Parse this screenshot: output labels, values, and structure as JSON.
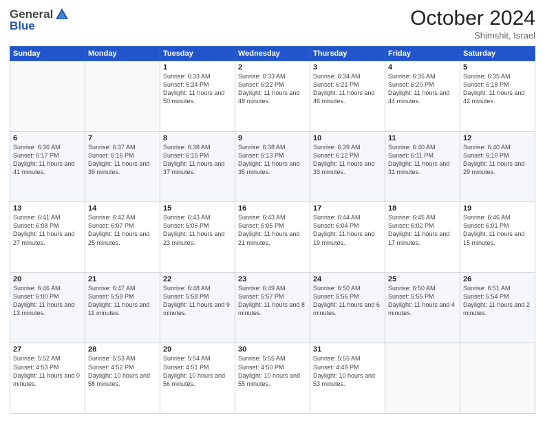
{
  "logo": {
    "general": "General",
    "blue": "Blue"
  },
  "title": "October 2024",
  "subtitle": "Shimshit, Israel",
  "weekdays": [
    "Sunday",
    "Monday",
    "Tuesday",
    "Wednesday",
    "Thursday",
    "Friday",
    "Saturday"
  ],
  "weeks": [
    [
      {
        "day": "",
        "sunrise": "",
        "sunset": "",
        "daylight": ""
      },
      {
        "day": "",
        "sunrise": "",
        "sunset": "",
        "daylight": ""
      },
      {
        "day": "1",
        "sunrise": "Sunrise: 6:33 AM",
        "sunset": "Sunset: 6:24 PM",
        "daylight": "Daylight: 11 hours and 50 minutes."
      },
      {
        "day": "2",
        "sunrise": "Sunrise: 6:33 AM",
        "sunset": "Sunset: 6:22 PM",
        "daylight": "Daylight: 11 hours and 48 minutes."
      },
      {
        "day": "3",
        "sunrise": "Sunrise: 6:34 AM",
        "sunset": "Sunset: 6:21 PM",
        "daylight": "Daylight: 11 hours and 46 minutes."
      },
      {
        "day": "4",
        "sunrise": "Sunrise: 6:35 AM",
        "sunset": "Sunset: 6:20 PM",
        "daylight": "Daylight: 11 hours and 44 minutes."
      },
      {
        "day": "5",
        "sunrise": "Sunrise: 6:35 AM",
        "sunset": "Sunset: 6:18 PM",
        "daylight": "Daylight: 11 hours and 42 minutes."
      }
    ],
    [
      {
        "day": "6",
        "sunrise": "Sunrise: 6:36 AM",
        "sunset": "Sunset: 6:17 PM",
        "daylight": "Daylight: 11 hours and 41 minutes."
      },
      {
        "day": "7",
        "sunrise": "Sunrise: 6:37 AM",
        "sunset": "Sunset: 6:16 PM",
        "daylight": "Daylight: 11 hours and 39 minutes."
      },
      {
        "day": "8",
        "sunrise": "Sunrise: 6:38 AM",
        "sunset": "Sunset: 6:15 PM",
        "daylight": "Daylight: 11 hours and 37 minutes."
      },
      {
        "day": "9",
        "sunrise": "Sunrise: 6:38 AM",
        "sunset": "Sunset: 6:13 PM",
        "daylight": "Daylight: 11 hours and 35 minutes."
      },
      {
        "day": "10",
        "sunrise": "Sunrise: 6:39 AM",
        "sunset": "Sunset: 6:12 PM",
        "daylight": "Daylight: 11 hours and 33 minutes."
      },
      {
        "day": "11",
        "sunrise": "Sunrise: 6:40 AM",
        "sunset": "Sunset: 6:11 PM",
        "daylight": "Daylight: 11 hours and 31 minutes."
      },
      {
        "day": "12",
        "sunrise": "Sunrise: 6:40 AM",
        "sunset": "Sunset: 6:10 PM",
        "daylight": "Daylight: 11 hours and 29 minutes."
      }
    ],
    [
      {
        "day": "13",
        "sunrise": "Sunrise: 6:41 AM",
        "sunset": "Sunset: 6:08 PM",
        "daylight": "Daylight: 11 hours and 27 minutes."
      },
      {
        "day": "14",
        "sunrise": "Sunrise: 6:42 AM",
        "sunset": "Sunset: 6:07 PM",
        "daylight": "Daylight: 11 hours and 25 minutes."
      },
      {
        "day": "15",
        "sunrise": "Sunrise: 6:43 AM",
        "sunset": "Sunset: 6:06 PM",
        "daylight": "Daylight: 11 hours and 23 minutes."
      },
      {
        "day": "16",
        "sunrise": "Sunrise: 6:43 AM",
        "sunset": "Sunset: 6:05 PM",
        "daylight": "Daylight: 11 hours and 21 minutes."
      },
      {
        "day": "17",
        "sunrise": "Sunrise: 6:44 AM",
        "sunset": "Sunset: 6:04 PM",
        "daylight": "Daylight: 11 hours and 19 minutes."
      },
      {
        "day": "18",
        "sunrise": "Sunrise: 6:45 AM",
        "sunset": "Sunset: 6:02 PM",
        "daylight": "Daylight: 11 hours and 17 minutes."
      },
      {
        "day": "19",
        "sunrise": "Sunrise: 6:46 AM",
        "sunset": "Sunset: 6:01 PM",
        "daylight": "Daylight: 11 hours and 15 minutes."
      }
    ],
    [
      {
        "day": "20",
        "sunrise": "Sunrise: 6:46 AM",
        "sunset": "Sunset: 6:00 PM",
        "daylight": "Daylight: 11 hours and 13 minutes."
      },
      {
        "day": "21",
        "sunrise": "Sunrise: 6:47 AM",
        "sunset": "Sunset: 5:59 PM",
        "daylight": "Daylight: 11 hours and 11 minutes."
      },
      {
        "day": "22",
        "sunrise": "Sunrise: 6:48 AM",
        "sunset": "Sunset: 5:58 PM",
        "daylight": "Daylight: 11 hours and 9 minutes."
      },
      {
        "day": "23",
        "sunrise": "Sunrise: 6:49 AM",
        "sunset": "Sunset: 5:57 PM",
        "daylight": "Daylight: 11 hours and 8 minutes."
      },
      {
        "day": "24",
        "sunrise": "Sunrise: 6:50 AM",
        "sunset": "Sunset: 5:56 PM",
        "daylight": "Daylight: 11 hours and 6 minutes."
      },
      {
        "day": "25",
        "sunrise": "Sunrise: 6:50 AM",
        "sunset": "Sunset: 5:55 PM",
        "daylight": "Daylight: 11 hours and 4 minutes."
      },
      {
        "day": "26",
        "sunrise": "Sunrise: 6:51 AM",
        "sunset": "Sunset: 5:54 PM",
        "daylight": "Daylight: 11 hours and 2 minutes."
      }
    ],
    [
      {
        "day": "27",
        "sunrise": "Sunrise: 5:52 AM",
        "sunset": "Sunset: 4:53 PM",
        "daylight": "Daylight: 11 hours and 0 minutes."
      },
      {
        "day": "28",
        "sunrise": "Sunrise: 5:53 AM",
        "sunset": "Sunset: 4:52 PM",
        "daylight": "Daylight: 10 hours and 58 minutes."
      },
      {
        "day": "29",
        "sunrise": "Sunrise: 5:54 AM",
        "sunset": "Sunset: 4:51 PM",
        "daylight": "Daylight: 10 hours and 56 minutes."
      },
      {
        "day": "30",
        "sunrise": "Sunrise: 5:55 AM",
        "sunset": "Sunset: 4:50 PM",
        "daylight": "Daylight: 10 hours and 55 minutes."
      },
      {
        "day": "31",
        "sunrise": "Sunrise: 5:55 AM",
        "sunset": "Sunset: 4:49 PM",
        "daylight": "Daylight: 10 hours and 53 minutes."
      },
      {
        "day": "",
        "sunrise": "",
        "sunset": "",
        "daylight": ""
      },
      {
        "day": "",
        "sunrise": "",
        "sunset": "",
        "daylight": ""
      }
    ]
  ]
}
